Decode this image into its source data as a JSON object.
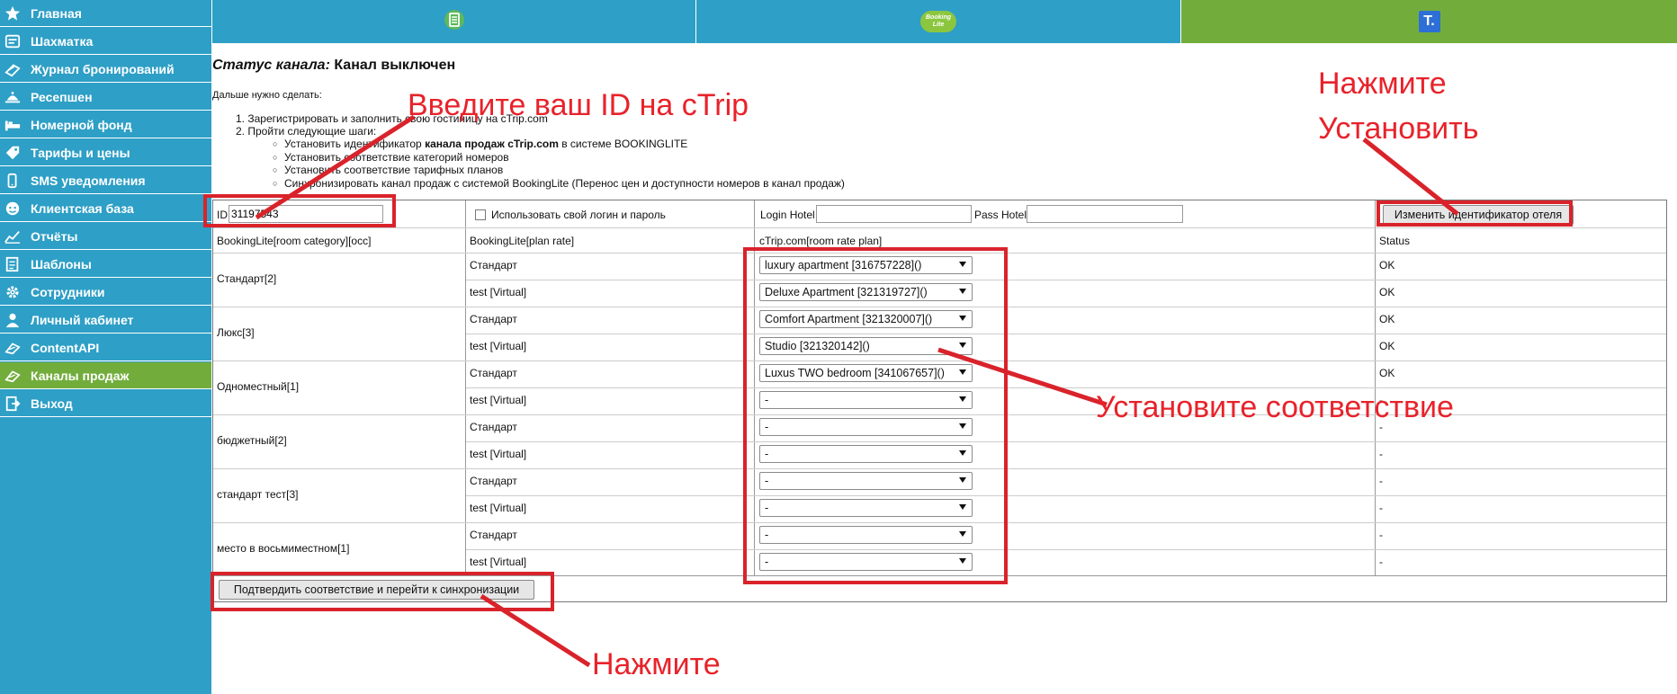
{
  "sidebar": {
    "items": [
      {
        "label": "Главная",
        "icon": "star-icon"
      },
      {
        "label": "Шахматка",
        "icon": "grid-icon"
      },
      {
        "label": "Журнал бронирований",
        "icon": "book-icon"
      },
      {
        "label": "Ресепшен",
        "icon": "reception-bell-icon"
      },
      {
        "label": "Номерной фонд",
        "icon": "bed-icon"
      },
      {
        "label": "Тарифы и цены",
        "icon": "price-tag-icon"
      },
      {
        "label": "SMS уведомления",
        "icon": "sms-icon"
      },
      {
        "label": "Клиентская база",
        "icon": "client-face-icon"
      },
      {
        "label": "Отчёты",
        "icon": "chart-icon"
      },
      {
        "label": "Шаблоны",
        "icon": "template-icon"
      },
      {
        "label": "Сотрудники",
        "icon": "gear-icon"
      },
      {
        "label": "Личный кабинет",
        "icon": "user-icon"
      },
      {
        "label": "ContentAPI",
        "icon": "api-icon"
      },
      {
        "label": "Каналы продаж",
        "icon": "sales-channels-icon",
        "active": true
      },
      {
        "label": "Выход",
        "icon": "exit-icon"
      }
    ]
  },
  "top_tabs": [
    {
      "icon": "channel-manager-icon"
    },
    {
      "icon": "bookinglite-logo-icon",
      "logo_text": "Booking Lite"
    },
    {
      "icon": "travelline-t-icon",
      "logo_text": "T."
    }
  ],
  "status": {
    "label": "Статус канала:",
    "value": "Канал выключен"
  },
  "next_steps_label": "Дальше нужно сделать:",
  "steps": [
    "1. Зарегистрировать и заполнить свою гостиницу на cTrip.com",
    "2. Пройти следующие шаги:"
  ],
  "sub_steps": [
    {
      "pre": "Установить идентификатор ",
      "bold": "канала продаж cTrip.com",
      "post": " в системе BOOKINGLITE"
    },
    {
      "pre": "Установить соответствие категорий номеров",
      "bold": "",
      "post": ""
    },
    {
      "pre": "Установить соответствие тарифных планов",
      "bold": "",
      "post": ""
    },
    {
      "pre": "Синхронизировать канал продаж с системой BookingLite (Перенос цен и доступности номеров в канал продаж)",
      "bold": "",
      "post": ""
    }
  ],
  "id_row": {
    "id_label": "ID",
    "id_value": "31197543",
    "use_own_login_label": "Использовать свой логин и пароль",
    "login_label": "Login Hotel",
    "pass_label": "Pass Hotel",
    "change_id_button": "Изменить идентификатор отеля"
  },
  "table": {
    "headers": [
      "BookingLite[room category][occ]",
      "BookingLite[plan rate]",
      "cTrip.com[room rate plan]",
      "Status"
    ],
    "categories": [
      "Стандарт[2]",
      "Люкс[3]",
      "Одноместный[1]",
      "бюджетный[2]",
      "стандарт тест[3]",
      "место в восьмиместном[1]"
    ],
    "rows": [
      {
        "plan": "Стандарт",
        "mapping": "luxury apartment [316757228]()",
        "status": "OK"
      },
      {
        "plan": "test [Virtual]",
        "mapping": "Deluxe Apartment [321319727]()",
        "status": "OK"
      },
      {
        "plan": "Стандарт",
        "mapping": "Comfort Apartment [321320007]()",
        "status": "OK"
      },
      {
        "plan": "test [Virtual]",
        "mapping": "Studio [321320142]()",
        "status": "OK"
      },
      {
        "plan": "Стандарт",
        "mapping": "Luxus TWO bedroom [341067657]()",
        "status": "OK"
      },
      {
        "plan": "test [Virtual]",
        "mapping": "-",
        "status": "-"
      },
      {
        "plan": "Стандарт",
        "mapping": "-",
        "status": "-"
      },
      {
        "plan": "test [Virtual]",
        "mapping": "-",
        "status": "-"
      },
      {
        "plan": "Стандарт",
        "mapping": "-",
        "status": "-"
      },
      {
        "plan": "test [Virtual]",
        "mapping": "-",
        "status": "-"
      },
      {
        "plan": "Стандарт",
        "mapping": "-",
        "status": "-"
      },
      {
        "plan": "test [Virtual]",
        "mapping": "-",
        "status": "-"
      }
    ]
  },
  "confirm_button": "Подтвердить соответствие и перейти к синхронизации",
  "annotations": {
    "enter_id": "Введите ваш ID на cTrip",
    "press_install_line1": "Нажмите",
    "press_install_line2": "Установить",
    "set_mapping": "Установите соответствие",
    "press": "Нажмите"
  },
  "colors": {
    "sidebar": "#2e9fc6",
    "active": "#72ad3c",
    "annotation": "#e8222a"
  }
}
